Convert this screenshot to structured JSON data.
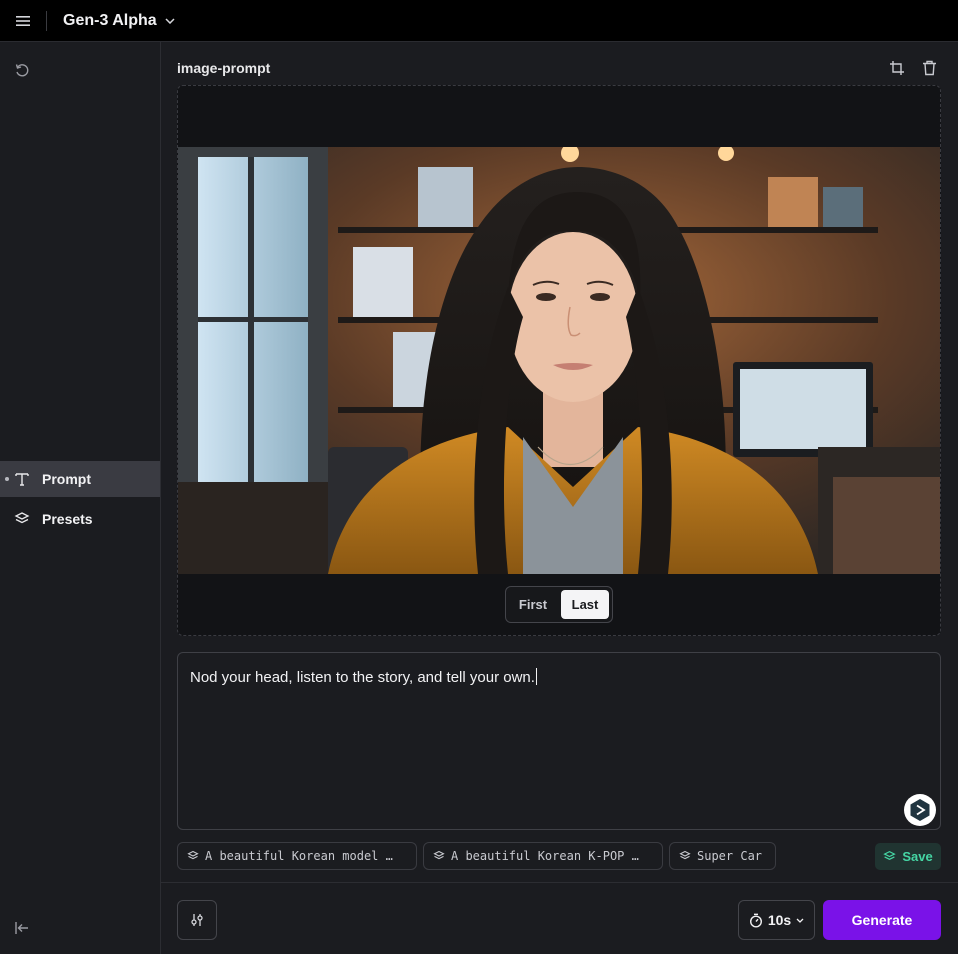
{
  "app": {
    "model_name": "Gen-3 Alpha",
    "menu_icon": "hamburger-menu-icon",
    "model_dropdown_icon": "chevron-down-icon"
  },
  "sidebar": {
    "items": [
      {
        "label": "Prompt",
        "icon": "text-t-icon",
        "active": true
      },
      {
        "label": "Presets",
        "icon": "layers-icon",
        "active": false
      }
    ],
    "top_icon": "reset-icon",
    "bottom_icon": "collapse-sidebar-icon"
  },
  "image_section": {
    "title": "image-prompt",
    "crop_icon": "crop-icon",
    "delete_icon": "trash-icon",
    "frame_toggle": {
      "options": [
        "First",
        "Last"
      ],
      "selected": "Last"
    }
  },
  "prompt": {
    "text": "Nod your head, listen to the story, and tell your own."
  },
  "presets": [
    {
      "label": "A beautiful Korean model …",
      "icon": "layers-icon"
    },
    {
      "label": "A beautiful Korean K-POP …",
      "icon": "layers-icon"
    },
    {
      "label": "Super Car",
      "icon": "layers-icon"
    }
  ],
  "save": {
    "label": "Save"
  },
  "footer": {
    "duration": "10s",
    "duration_icon": "stopwatch-icon",
    "generate_label": "Generate",
    "settings_icon": "sliders-icon"
  },
  "colors": {
    "accent": "#7a12e8",
    "save_green": "#45d6a4",
    "background": "#1b1c20",
    "topbar": "#000000"
  }
}
